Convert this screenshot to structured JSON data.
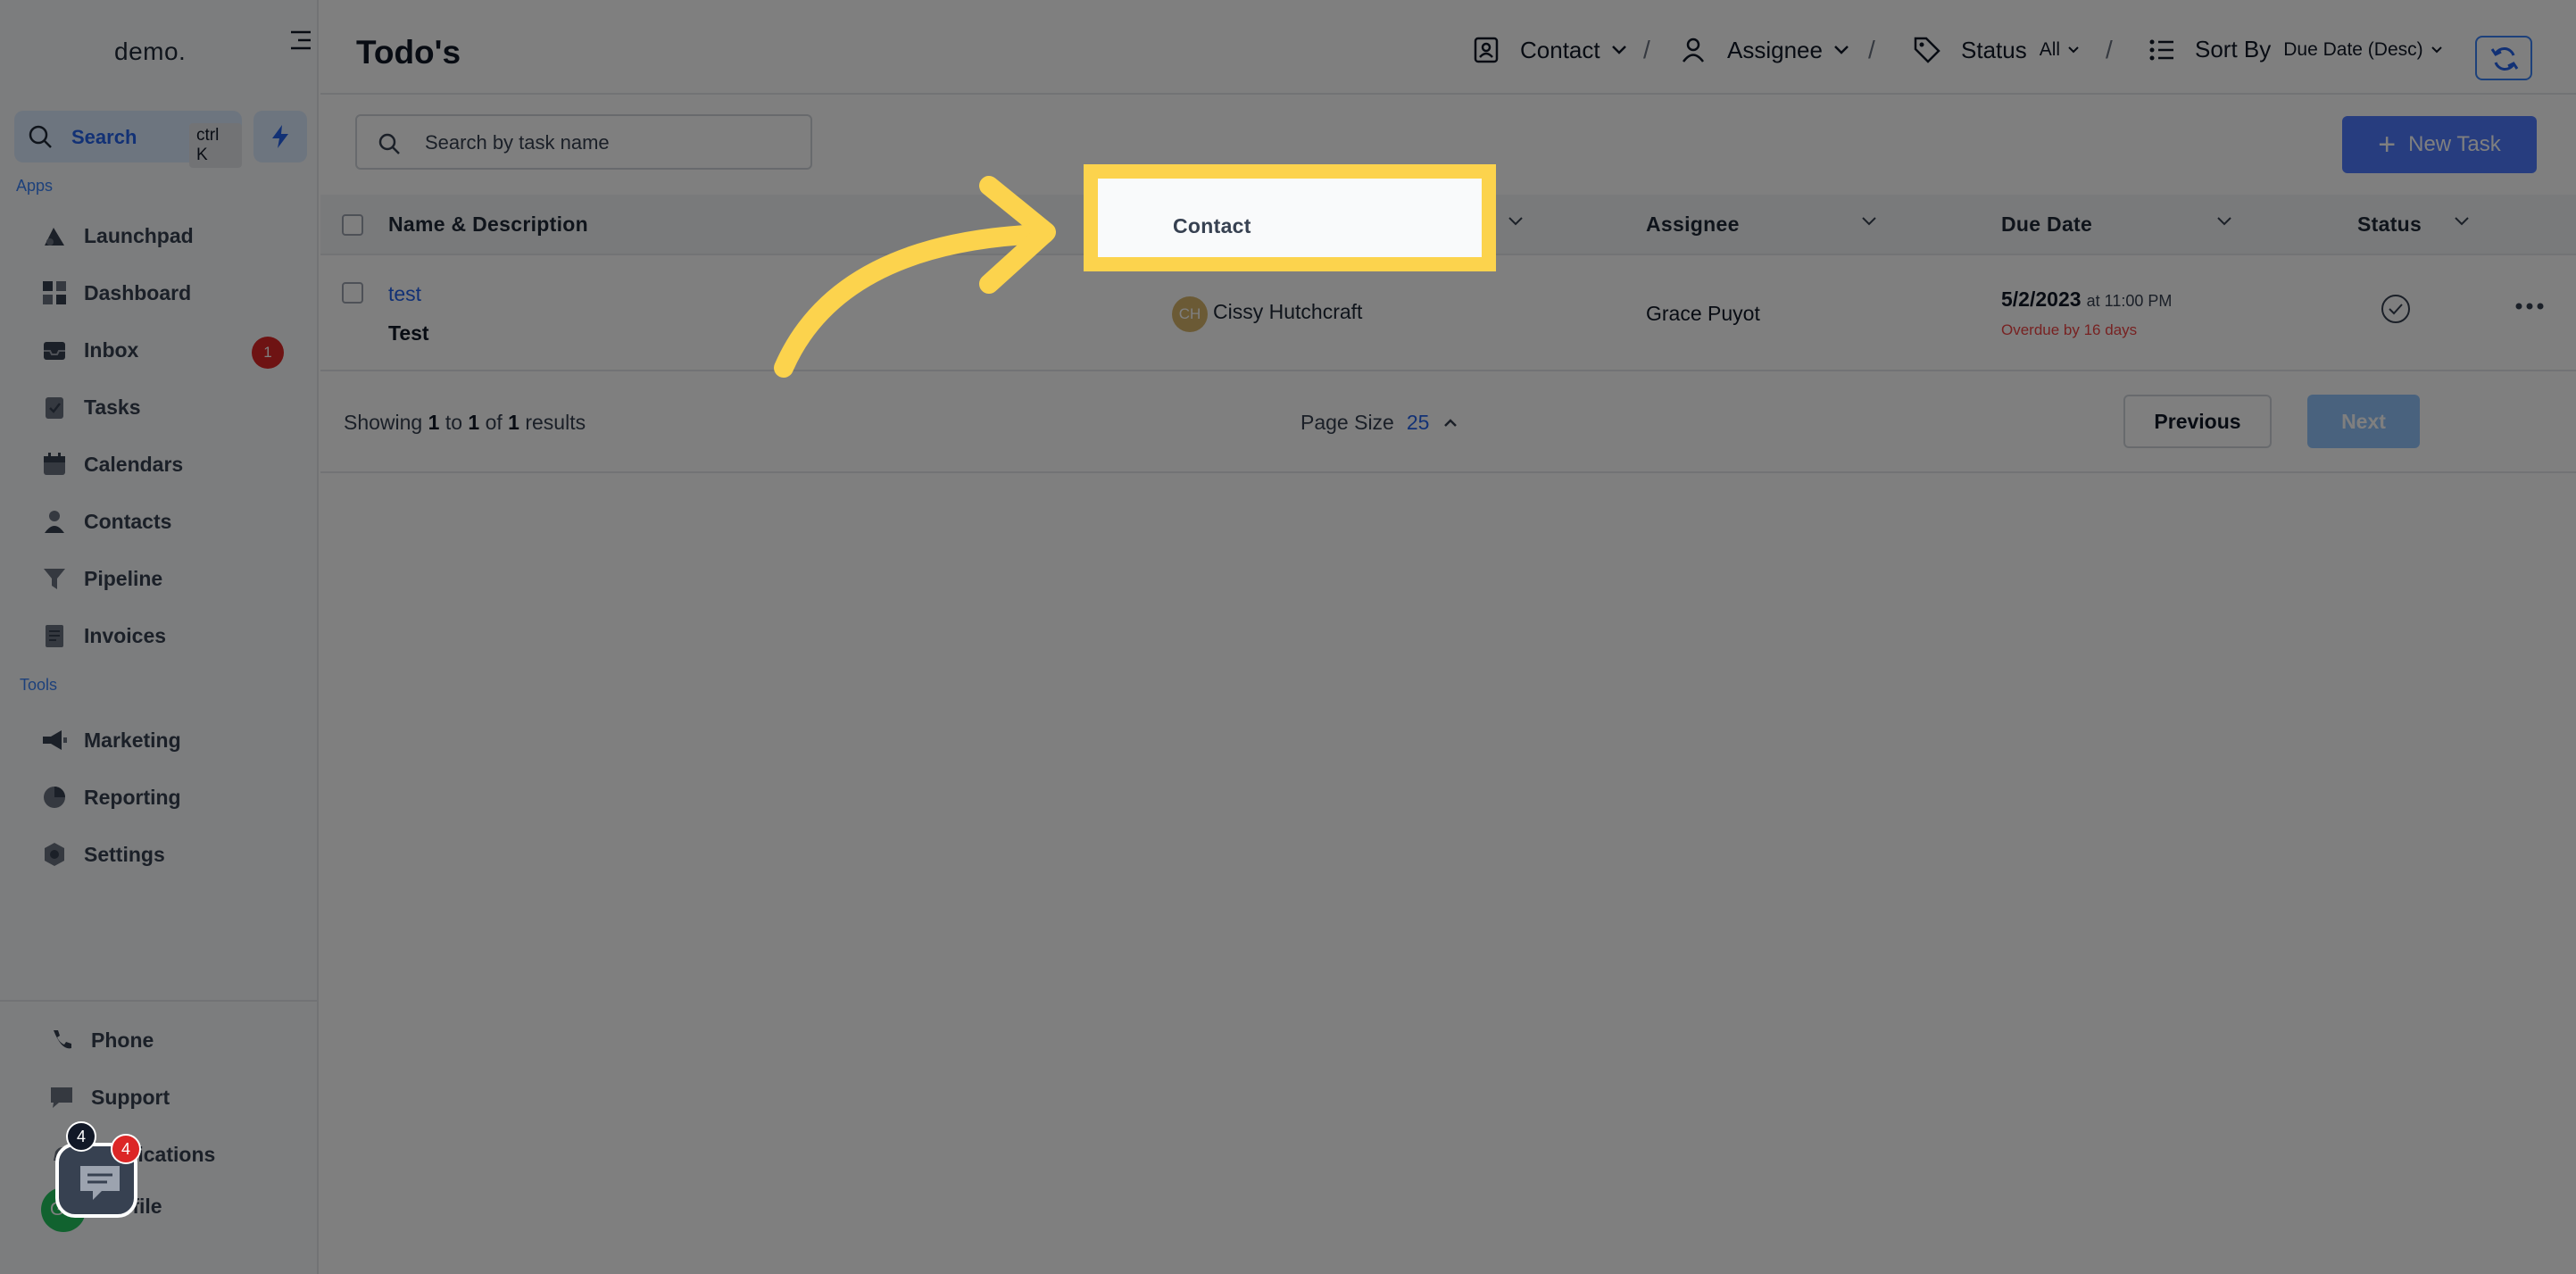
{
  "sidebar": {
    "brand": "demo.",
    "search": {
      "label": "Search",
      "shortcut": "ctrl K"
    },
    "apps_label": "Apps",
    "tools_label": "Tools",
    "apps": [
      {
        "label": "Launchpad",
        "icon": "rocket-icon"
      },
      {
        "label": "Dashboard",
        "icon": "grid-icon"
      },
      {
        "label": "Inbox",
        "icon": "inbox-icon",
        "badge": "1"
      },
      {
        "label": "Tasks",
        "icon": "tasks-icon"
      },
      {
        "label": "Calendars",
        "icon": "calendar-icon"
      },
      {
        "label": "Contacts",
        "icon": "person-icon"
      },
      {
        "label": "Pipeline",
        "icon": "funnel-icon"
      },
      {
        "label": "Invoices",
        "icon": "invoice-icon"
      }
    ],
    "tools": [
      {
        "label": "Marketing",
        "icon": "megaphone-icon"
      },
      {
        "label": "Reporting",
        "icon": "pie-chart-icon"
      },
      {
        "label": "Settings",
        "icon": "gear-icon"
      }
    ],
    "bottom": [
      {
        "label": "Phone",
        "icon": "phone-icon"
      },
      {
        "label": "Support",
        "icon": "chat-icon"
      },
      {
        "label": "Notifications",
        "icon": "bell-icon"
      },
      {
        "label": "Profile",
        "icon": "avatar-icon"
      }
    ],
    "avatar_initials": "GP",
    "chat_widget": {
      "badge_dark": "4",
      "badge_red": "4"
    }
  },
  "header": {
    "title": "Todo's",
    "filters": {
      "contact": "Contact",
      "assignee": "Assignee",
      "status": "Status",
      "status_value": "All",
      "sort_by": "Sort By",
      "sort_value": "Due Date (Desc)"
    },
    "separator": "/"
  },
  "toolbar": {
    "search_placeholder": "Search by task name",
    "new_task": "New Task"
  },
  "table": {
    "columns": {
      "name": "Name & Description",
      "contact": "Contact",
      "assignee": "Assignee",
      "due_date": "Due Date",
      "status": "Status"
    },
    "rows": [
      {
        "name": "test",
        "description": "Test",
        "contact_initials": "CH",
        "contact": "Cissy Hutchcraft",
        "assignee": "Grace Puyot",
        "due_date": "5/2/2023",
        "due_time": "at 11:00 PM",
        "overdue": "Overdue by 16 days"
      }
    ]
  },
  "pagination": {
    "showing_prefix": "Showing",
    "from": "1",
    "to_word": "to",
    "to": "1",
    "of_word": "of",
    "total": "1",
    "results_word": "results",
    "page_size_label": "Page Size",
    "page_size": "25",
    "previous": "Previous",
    "next": "Next"
  },
  "spotlight": {
    "label": "Contact"
  }
}
